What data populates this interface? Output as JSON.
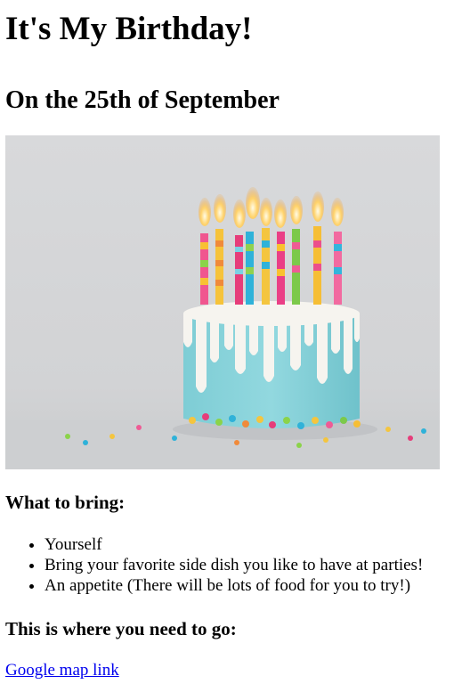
{
  "page": {
    "title": "It's My Birthday!",
    "subtitle": "On the 25th of September"
  },
  "hero_image": {
    "alt": "birthday cake with candles"
  },
  "bring": {
    "heading": "What to bring:",
    "items": [
      "Yourself",
      "Bring your favorite side dish you like to have at parties!",
      "An appetite (There will be lots of food for you to try!)"
    ]
  },
  "directions": {
    "heading": "This is where you need to go:",
    "link_text": "Google map link"
  },
  "colors": {
    "link": "#0000ee",
    "cake_frosting": "#7fcfd6",
    "drip": "#f5f3ee",
    "background": "#d3d4d6"
  }
}
